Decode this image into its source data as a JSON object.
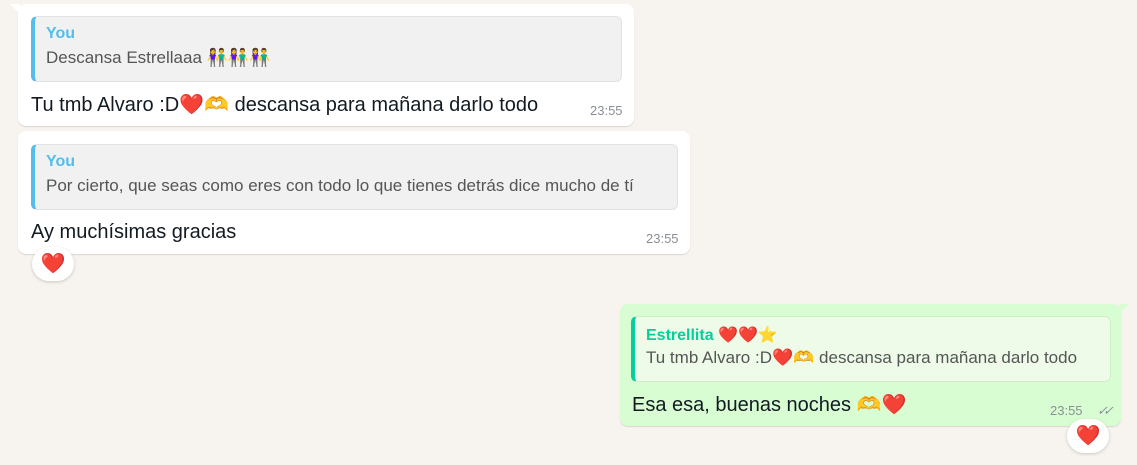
{
  "messages": [
    {
      "direction": "incoming",
      "quote_author": "You",
      "quote_text": "Descansa Estrellaaa",
      "quote_emojis": "👫👫👫",
      "text_before": "Tu tmb Alvaro :D",
      "text_emoji": "❤️🫶",
      "text_after": " descansa para mañana darlo todo",
      "time": "23:55"
    },
    {
      "direction": "incoming",
      "quote_author": "You",
      "quote_text": "Por cierto, que seas como eres con todo lo que tienes detrás dice mucho de tí",
      "text": "Ay muchísimas gracias",
      "time": "23:55",
      "reaction": "❤️"
    },
    {
      "direction": "outgoing",
      "quote_author": "Estrellita",
      "quote_author_emojis": "❤️❤️⭐",
      "quote_text_before": "Tu tmb Alvaro :D",
      "quote_text_emoji": "❤️🫶",
      "quote_text_after": " descansa para mañana darlo todo",
      "text": "Esa esa, buenas noches ",
      "text_emoji": "🫶❤️",
      "time": "23:55",
      "ticks": "✓✓",
      "reaction": "❤️"
    }
  ],
  "colors": {
    "incoming_bubble": "#ffffff",
    "outgoing_bubble": "#d9fdd3",
    "you_author": "#53bdeb",
    "contact_author": "#06cf9c",
    "background": "#f7f3ee"
  }
}
